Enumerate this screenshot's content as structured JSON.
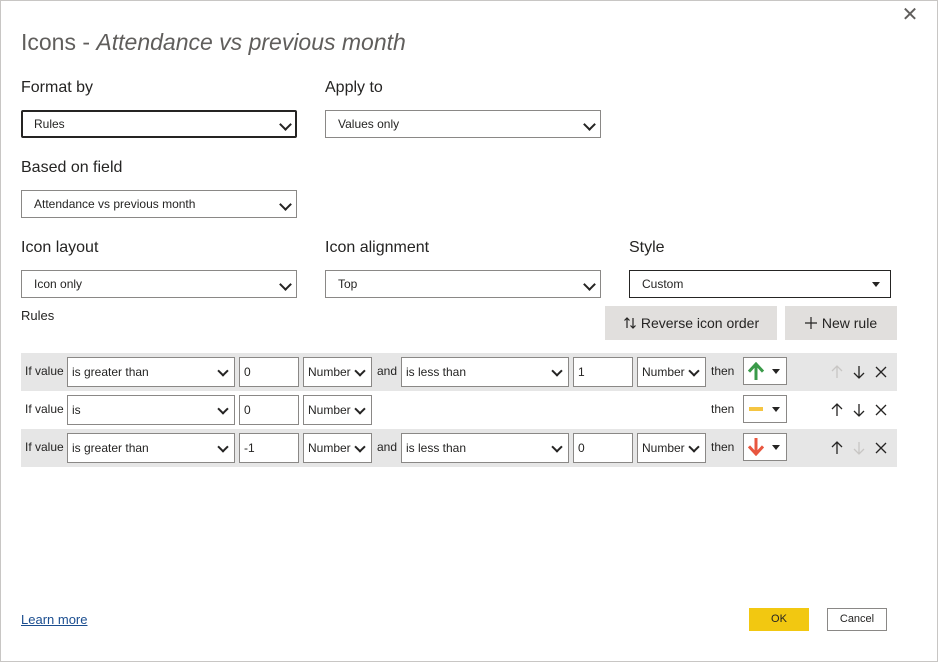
{
  "dialog": {
    "title_prefix": "Icons - ",
    "title_field": "Attendance vs previous month",
    "close_icon": "close-icon"
  },
  "format_by": {
    "label": "Format by",
    "value": "Rules"
  },
  "apply_to": {
    "label": "Apply to",
    "value": "Values only"
  },
  "based_on_field": {
    "label": "Based on field",
    "value": "Attendance vs previous month"
  },
  "icon_layout": {
    "label": "Icon layout",
    "value": "Icon only"
  },
  "icon_alignment": {
    "label": "Icon alignment",
    "value": "Top"
  },
  "style": {
    "label": "Style",
    "value": "Custom"
  },
  "rules_section": {
    "label": "Rules",
    "reverse_button": "Reverse icon order",
    "new_rule_button": "New rule"
  },
  "rules": [
    {
      "if_label": "If value",
      "op1": "is greater than",
      "val1": "0",
      "type1": "Number",
      "and_label": "and",
      "op2": "is less than",
      "val2": "1",
      "type2": "Number",
      "then_label": "then",
      "icon": "green-up-arrow-icon",
      "icon_color": "#3a9a49"
    },
    {
      "if_label": "If value",
      "op1": "is",
      "val1": "0",
      "type1": "Number",
      "then_label": "then",
      "icon": "yellow-dash-icon",
      "icon_color": "#f5c542"
    },
    {
      "if_label": "If value",
      "op1": "is greater than",
      "val1": "-1",
      "type1": "Number",
      "and_label": "and",
      "op2": "is less than",
      "val2": "0",
      "type2": "Number",
      "then_label": "then",
      "icon": "red-down-arrow-icon",
      "icon_color": "#e8563f"
    }
  ],
  "footer": {
    "learn_more": "Learn more",
    "ok": "OK",
    "cancel": "Cancel"
  },
  "colors": {
    "accent": "#f2c811",
    "link": "#1a4d8f",
    "shade": "#e6e6e6"
  }
}
